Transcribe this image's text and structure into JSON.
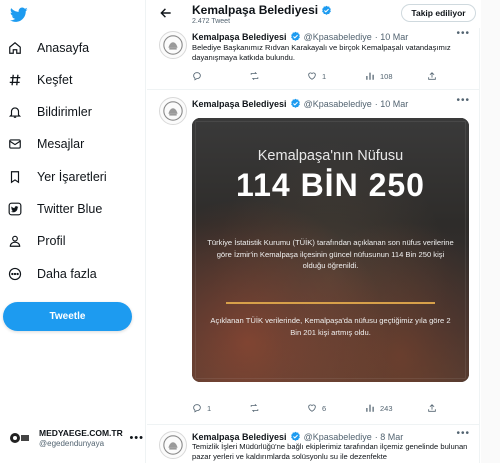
{
  "sidebar": {
    "items": [
      {
        "label": "Anasayfa",
        "icon": "home-icon"
      },
      {
        "label": "Keşfet",
        "icon": "hashtag-icon"
      },
      {
        "label": "Bildirimler",
        "icon": "bell-icon"
      },
      {
        "label": "Mesajlar",
        "icon": "mail-icon"
      },
      {
        "label": "Yer İşaretleri",
        "icon": "bookmark-icon"
      },
      {
        "label": "Twitter Blue",
        "icon": "twitter-blue-icon"
      },
      {
        "label": "Profil",
        "icon": "profile-icon"
      },
      {
        "label": "Daha fazla",
        "icon": "more-circle-icon"
      }
    ],
    "tweet_button": "Tweetle",
    "account": {
      "name": "MEDYAEGE.COM.TR",
      "handle": "@egedendunyaya"
    }
  },
  "header": {
    "name": "Kemalpaşa Belediyesi",
    "tweet_count": "2.472 Tweet",
    "follow_label": "Takip ediliyor"
  },
  "tweets": [
    {
      "name": "Kemalpaşa Belediyesi",
      "handle": "@Kpasabelediye",
      "date": "· 10 Mar",
      "text": "Belediye Başkanımız Rıdvan Karakayalı ve birçok Kemalpaşalı vatandaşımız dayanışmaya katkıda bulundu.",
      "replies": "",
      "retweets": "",
      "likes": "1",
      "views": "108"
    },
    {
      "name": "Kemalpaşa Belediyesi",
      "handle": "@Kpasabelediye",
      "date": "· 10 Mar",
      "media": {
        "title": "Kemalpaşa'nın Nüfusu",
        "big": "114 BİN 250",
        "p1": "Türkiye İstatistik Kurumu (TÜİK) tarafından açıklanan son nüfus verilerine göre İzmir'in Kemalpaşa ilçesinin güncel nüfusunun 114 Bin 250 kişi olduğu öğrenildi.",
        "p2": "Açıklanan TÜİK verilerinde, Kemalpaşa'da nüfusu geçtiğimiz yıla göre 2 Bin 201 kişi artmış oldu."
      },
      "replies": "1",
      "retweets": "",
      "likes": "6",
      "views": "243"
    },
    {
      "name": "Kemalpaşa Belediyesi",
      "handle": "@Kpasabelediye",
      "date": "· 8 Mar",
      "text": "Temizlik İşleri Müdürlüğü'ne bağlı ekiplerimiz tarafından ilçemiz genelinde bulunan pazar yerleri ve kaldırımlarda solüsyonlu su ile dezenfekte"
    }
  ],
  "colors": {
    "accent": "#1d9bf0",
    "verified": "#1d9bf0",
    "media_divider": "#d7a04a"
  }
}
